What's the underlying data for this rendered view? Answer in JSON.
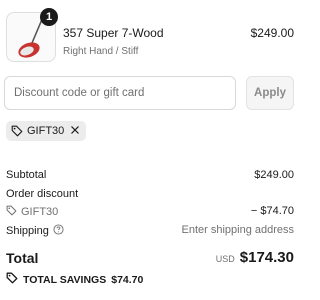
{
  "line_item": {
    "image_icon": "golf-club-fairway-wood-icon",
    "quantity": "1",
    "name": "357 Super 7-Wood",
    "variant": "Right Hand / Stiff",
    "price": "$249.00"
  },
  "discount": {
    "placeholder": "Discount code or gift card",
    "value": "",
    "apply_label": "Apply",
    "applied_code": "GIFT30"
  },
  "summary": {
    "subtotal_label": "Subtotal",
    "subtotal_value": "$249.00",
    "order_discount_label": "Order discount",
    "discount_code": "GIFT30",
    "discount_value": "− $74.70",
    "shipping_label": "Shipping",
    "shipping_value": "Enter shipping address",
    "total_label": "Total",
    "currency": "USD",
    "total_value": "$174.30",
    "savings_label": "TOTAL SAVINGS",
    "savings_value": "$74.70"
  },
  "colors": {
    "text": "#1a1a1a",
    "muted": "#707070",
    "badge": "#1a1a1a",
    "chip": "#ececec",
    "club_head": "#c8322f"
  }
}
